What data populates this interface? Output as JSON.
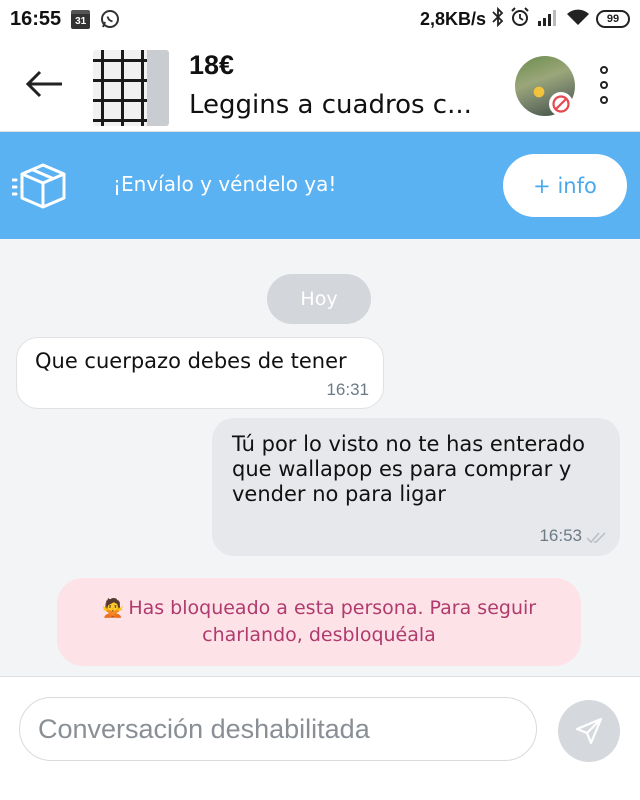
{
  "status_bar": {
    "time": "16:55",
    "calendar_day": "31",
    "net_speed": "2,8KB/s",
    "battery": "99"
  },
  "header": {
    "price": "18€",
    "title": "Leggins a cuadros c..."
  },
  "banner": {
    "text": "¡Envíalo y véndelo ya!",
    "button_label": "+ info",
    "color": "#5ab2f3"
  },
  "chat": {
    "day_label": "Hoy",
    "messages": [
      {
        "direction": "incoming",
        "text": "Que cuerpazo debes de tener",
        "time": "16:31"
      },
      {
        "direction": "outgoing",
        "text": "Tú por lo visto no te has enterado que wallapop es para comprar y vender no para ligar",
        "time": "16:53"
      }
    ],
    "blocked_notice": {
      "emoji": "🙅",
      "text": "Has bloqueado a esta persona. Para seguir charlando, desbloquéala",
      "color": "#b03a6d"
    }
  },
  "composer": {
    "placeholder": "Conversación deshabilitada"
  }
}
